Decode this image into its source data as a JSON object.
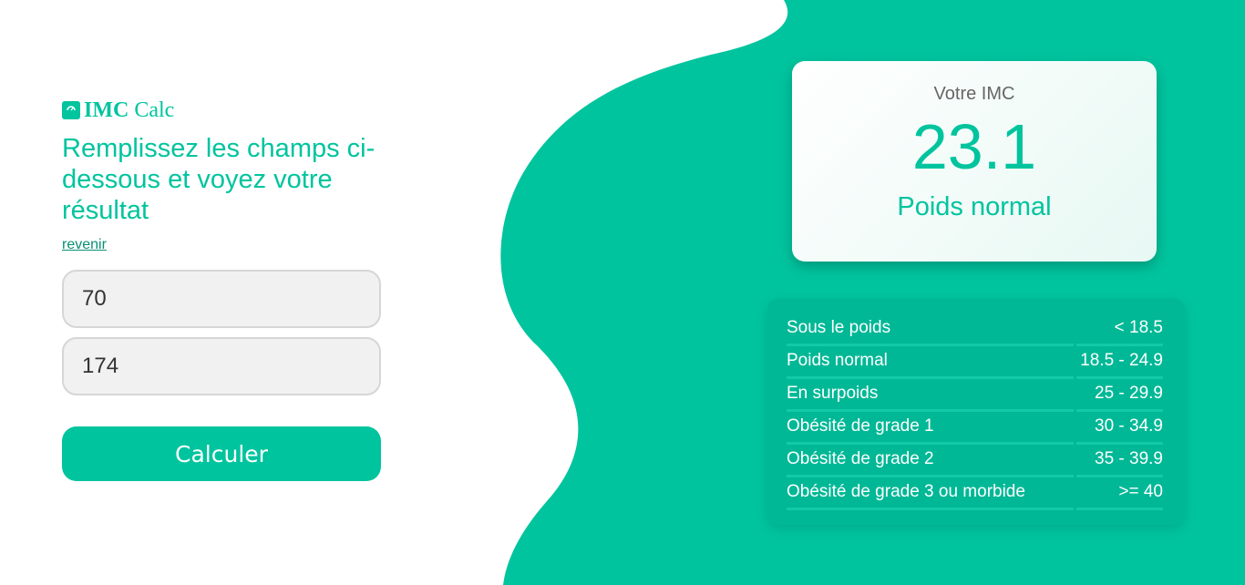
{
  "colors": {
    "accent": "#00c49e",
    "panel": "#00b896",
    "panel_rule": "#13caa6",
    "background": "#ffffff"
  },
  "logo": {
    "icon": "scale-icon",
    "bold_text": "IMC",
    "text": " Calc"
  },
  "form": {
    "headline": "Remplissez les champs ci-dessous et voyez votre résultat",
    "back_link": "revenir",
    "weight_value": "70",
    "height_value": "174",
    "submit_label": "Calculer"
  },
  "result": {
    "label": "Votre IMC",
    "value": "23.1",
    "category": "Poids normal"
  },
  "reference_table": {
    "rows": [
      {
        "category": "Sous le poids",
        "range": "< 18.5"
      },
      {
        "category": "Poids normal",
        "range": "18.5 - 24.9"
      },
      {
        "category": "En surpoids",
        "range": "25 - 29.9"
      },
      {
        "category": "Obésité de grade 1",
        "range": "30 - 34.9"
      },
      {
        "category": "Obésité de grade 2",
        "range": "35 - 39.9"
      },
      {
        "category": "Obésité de grade 3 ou morbide",
        "range": ">= 40"
      }
    ]
  }
}
